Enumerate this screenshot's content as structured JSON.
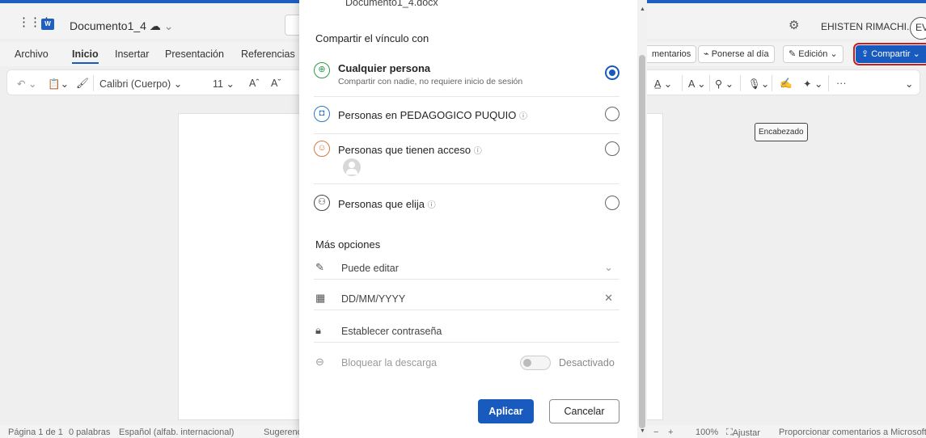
{
  "app": {
    "doc_title": "Documento1_4",
    "user_name": "EHISTEN RIMACHI...",
    "user_initials": "EV"
  },
  "menu": {
    "items": [
      "Archivo",
      "Inicio",
      "Insertar",
      "Presentación",
      "Referencias"
    ],
    "active": "Inicio"
  },
  "ribbon_buttons": {
    "comments": "mentarios",
    "catch_up": "Ponerse al día",
    "editing": "Edición",
    "share": "Compartir"
  },
  "toolbar": {
    "font_name": "Calibri (Cuerpo)",
    "font_size": "11",
    "grow": "A",
    "shrink": "A"
  },
  "header_tooltip": "Encabezado",
  "statusbar": {
    "page": "Página 1 de 1",
    "words": "0 palabras",
    "language": "Español (alfab. internacional)",
    "suggestions": "Sugerenc",
    "zoom": "100%",
    "fit": "Ajustar",
    "feedback": "Proporcionar comentarios a Microsoft"
  },
  "dialog": {
    "doc_name": "Documento1_4.docx",
    "heading": "Compartir el vínculo con",
    "options": [
      {
        "label": "Cualquier persona",
        "sub": "Compartir con nadie, no requiere inicio de sesión",
        "selected": true
      },
      {
        "label": "Personas en PEDAGOGICO PUQUIO",
        "selected": false
      },
      {
        "label": "Personas que tienen acceso",
        "selected": false
      },
      {
        "label": "Personas que elija",
        "selected": false
      }
    ],
    "more_heading": "Más opciones",
    "permission": "Puede editar",
    "date_placeholder": "DD/MM/YYYY",
    "password": "Establecer contraseña",
    "block_download": "Bloquear la descarga",
    "block_download_state": "Desactivado",
    "apply": "Aplicar",
    "cancel": "Cancelar"
  },
  "colors": {
    "accent": "#185abd",
    "highlight_outline": "#c41e1e"
  }
}
